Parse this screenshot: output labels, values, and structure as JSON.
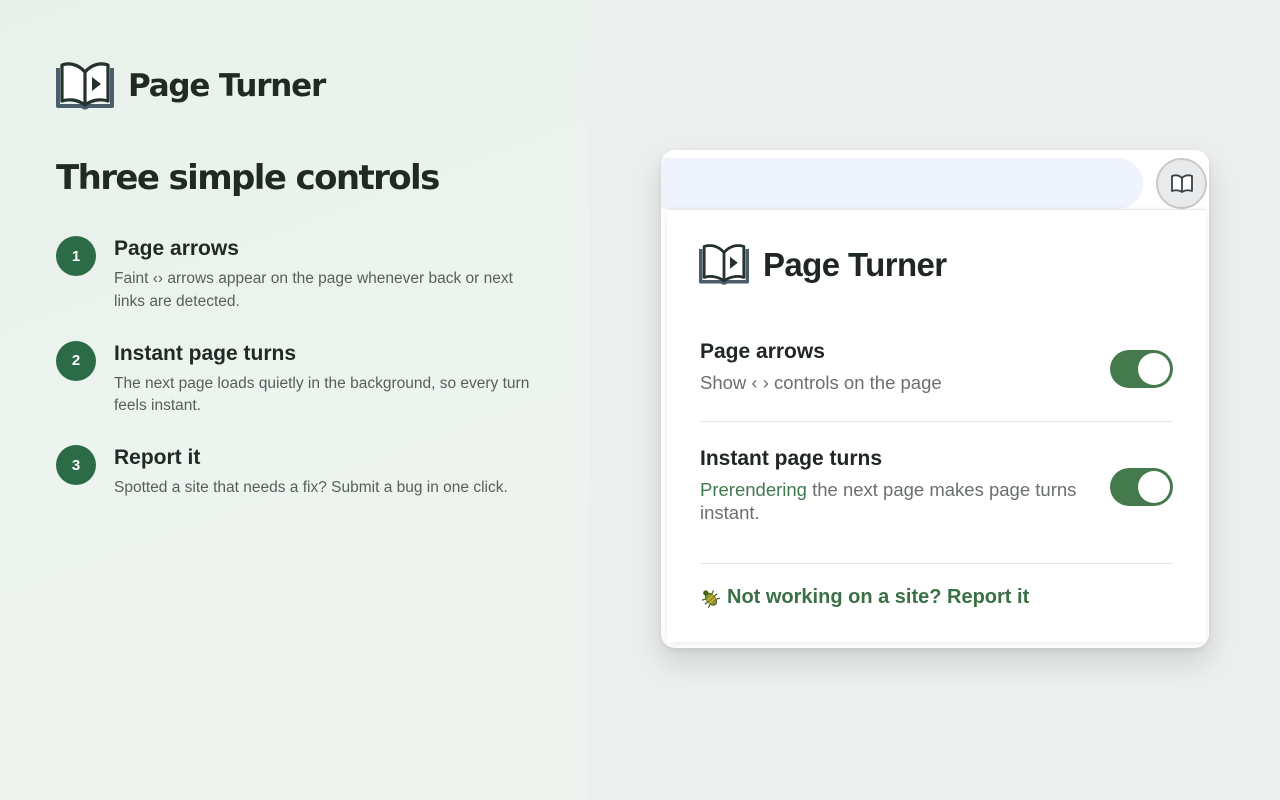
{
  "brand": {
    "name": "Page Turner",
    "logo_icon": "book-play-icon"
  },
  "headline": "Three simple controls",
  "features": [
    {
      "number": "1",
      "title": "Page arrows",
      "description": "Faint ‹› arrows appear on the page whenever back or next links are detected."
    },
    {
      "number": "2",
      "title": "Instant page turns",
      "description": "The next page loads quietly in the background, so every turn feels instant."
    },
    {
      "number": "3",
      "title": "Report it",
      "description": "Spotted a site that needs a fix? Submit a bug in one click."
    }
  ],
  "browser": {
    "extension_icon": "open-book-icon"
  },
  "popup": {
    "title": "Page Turner",
    "settings": [
      {
        "title": "Page arrows",
        "description": "Show ‹ › controls on the page",
        "enabled": true
      },
      {
        "title": "Instant page turns",
        "description_highlight": "Prerendering",
        "description_rest": " the next page makes page turns instant.",
        "enabled": true
      }
    ],
    "report_link": "Not working on a site? Report it",
    "report_icon": "bug-icon"
  },
  "colors": {
    "accent_green": "#2b6b45",
    "toggle_on": "#457a4d",
    "link_green": "#3b7047",
    "heading": "#1f2a24"
  }
}
